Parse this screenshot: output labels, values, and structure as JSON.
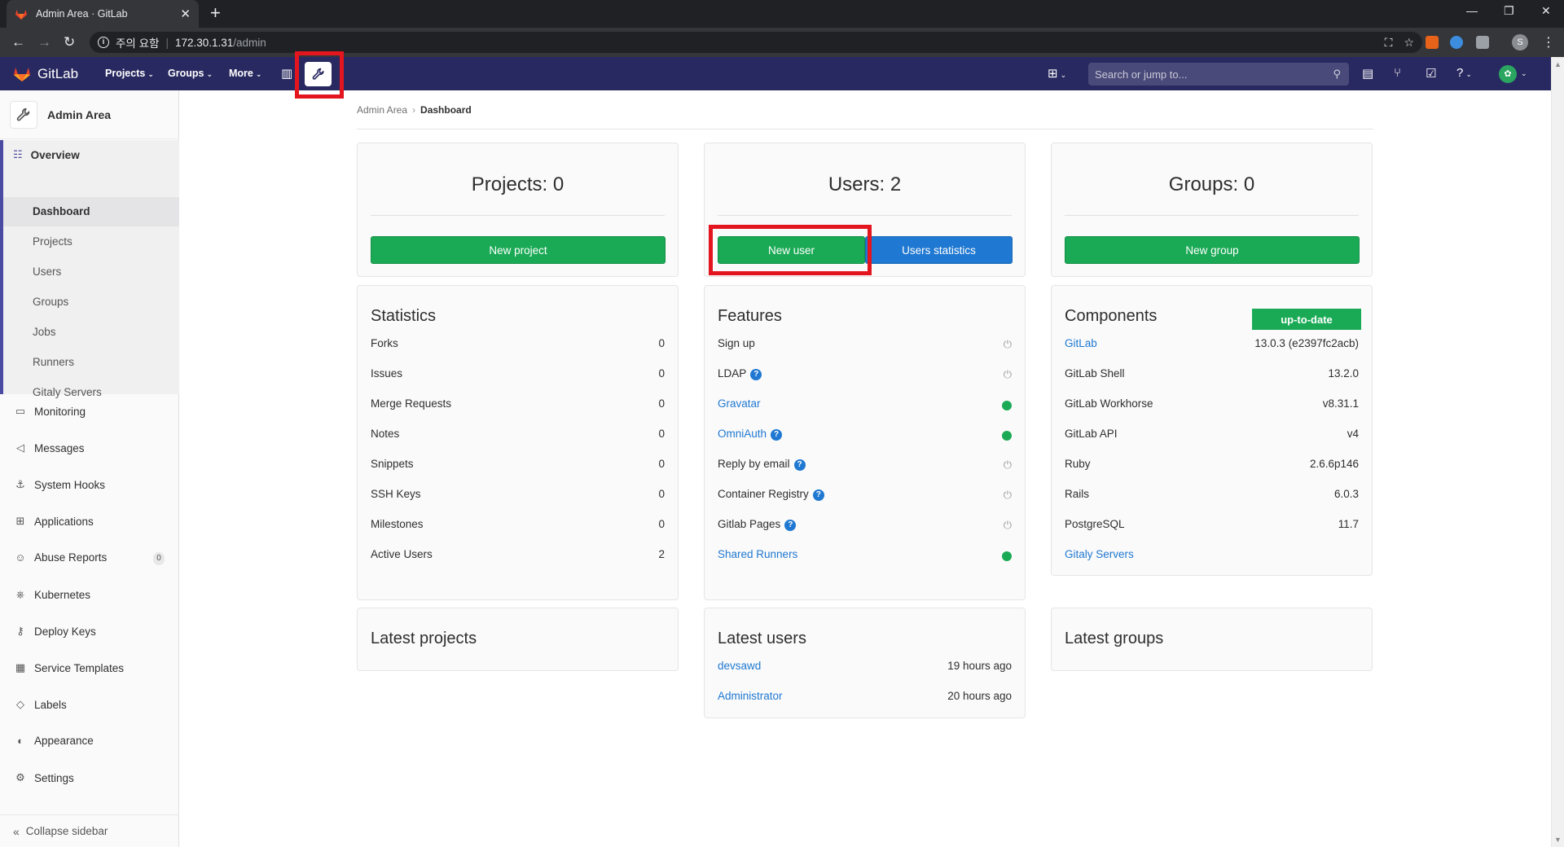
{
  "browser": {
    "tab_title": "Admin Area · GitLab",
    "address_warning": "주의 요함",
    "address_host": "172.30.1.31",
    "address_path": "/admin"
  },
  "header": {
    "brand": "GitLab",
    "nav": [
      "Projects",
      "Groups",
      "More"
    ],
    "search_placeholder": "Search or jump to..."
  },
  "sidebar": {
    "title": "Admin Area",
    "overview": "Overview",
    "overview_items": [
      "Dashboard",
      "Projects",
      "Users",
      "Groups",
      "Jobs",
      "Runners",
      "Gitaly Servers"
    ],
    "items": [
      {
        "label": "Monitoring",
        "icon": "monitor-icon"
      },
      {
        "label": "Messages",
        "icon": "megaphone-icon"
      },
      {
        "label": "System Hooks",
        "icon": "hook-icon"
      },
      {
        "label": "Applications",
        "icon": "grid-icon"
      },
      {
        "label": "Abuse Reports",
        "icon": "abuse-icon"
      },
      {
        "label": "Kubernetes",
        "icon": "kubernetes-icon"
      },
      {
        "label": "Deploy Keys",
        "icon": "key-icon"
      },
      {
        "label": "Service Templates",
        "icon": "template-icon"
      },
      {
        "label": "Labels",
        "icon": "label-icon"
      },
      {
        "label": "Appearance",
        "icon": "palette-icon"
      },
      {
        "label": "Settings",
        "icon": "gear-icon"
      }
    ],
    "abuse_count": "0",
    "collapse": "Collapse sidebar"
  },
  "breadcrumb": {
    "parent": "Admin Area",
    "current": "Dashboard"
  },
  "projects_card": {
    "title": "Projects: 0",
    "button": "New project"
  },
  "users_card": {
    "title": "Users: 2",
    "button_new": "New user",
    "button_stats": "Users statistics"
  },
  "groups_card": {
    "title": "Groups: 0",
    "button": "New group"
  },
  "statistics": {
    "title": "Statistics",
    "rows": [
      {
        "label": "Forks",
        "value": "0"
      },
      {
        "label": "Issues",
        "value": "0"
      },
      {
        "label": "Merge Requests",
        "value": "0"
      },
      {
        "label": "Notes",
        "value": "0"
      },
      {
        "label": "Snippets",
        "value": "0"
      },
      {
        "label": "SSH Keys",
        "value": "0"
      },
      {
        "label": "Milestones",
        "value": "0"
      },
      {
        "label": "Active Users",
        "value": "2"
      }
    ]
  },
  "features": {
    "title": "Features",
    "rows": [
      {
        "label": "Sign up",
        "link": false,
        "help": false,
        "enabled": false
      },
      {
        "label": "LDAP",
        "link": false,
        "help": true,
        "enabled": false
      },
      {
        "label": "Gravatar",
        "link": true,
        "help": false,
        "enabled": true
      },
      {
        "label": "OmniAuth",
        "link": true,
        "help": true,
        "enabled": true
      },
      {
        "label": "Reply by email",
        "link": false,
        "help": true,
        "enabled": false
      },
      {
        "label": "Container Registry",
        "link": false,
        "help": true,
        "enabled": false
      },
      {
        "label": "Gitlab Pages",
        "link": false,
        "help": true,
        "enabled": false
      },
      {
        "label": "Shared Runners",
        "link": true,
        "help": false,
        "enabled": true
      }
    ]
  },
  "components": {
    "title": "Components",
    "status": "up-to-date",
    "rows": [
      {
        "label": "GitLab",
        "value": "13.0.3 (e2397fc2acb)",
        "link": true
      },
      {
        "label": "GitLab Shell",
        "value": "13.2.0",
        "link": false
      },
      {
        "label": "GitLab Workhorse",
        "value": "v8.31.1",
        "link": false
      },
      {
        "label": "GitLab API",
        "value": "v4",
        "link": false
      },
      {
        "label": "Ruby",
        "value": "2.6.6p146",
        "link": false
      },
      {
        "label": "Rails",
        "value": "6.0.3",
        "link": false
      },
      {
        "label": "PostgreSQL",
        "value": "11.7",
        "link": false
      },
      {
        "label": "Gitaly Servers",
        "value": "",
        "link": true
      }
    ]
  },
  "latest_projects": {
    "title": "Latest projects"
  },
  "latest_users": {
    "title": "Latest users",
    "rows": [
      {
        "label": "devsawd",
        "value": "19 hours ago"
      },
      {
        "label": "Administrator",
        "value": "20 hours ago"
      }
    ]
  },
  "latest_groups": {
    "title": "Latest groups"
  },
  "colors": {
    "header_bg": "#292961",
    "green": "#1aaa55",
    "blue": "#1f78d1",
    "highlight_red": "#e3151f"
  }
}
